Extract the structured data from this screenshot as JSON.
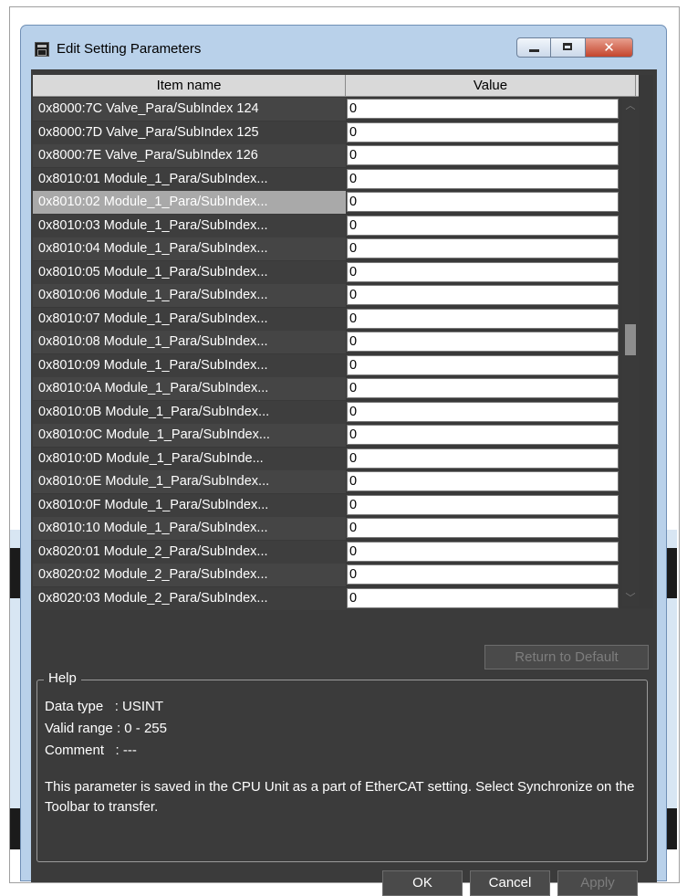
{
  "window": {
    "title": "Edit Setting Parameters",
    "controls": {
      "minimize": "minimize",
      "maximize": "maximize",
      "close": "✕"
    }
  },
  "grid": {
    "headers": {
      "name": "Item name",
      "value": "Value"
    },
    "rows": [
      {
        "name": "0x8000:7C Valve_Para/SubIndex 124",
        "value": "0"
      },
      {
        "name": "0x8000:7D Valve_Para/SubIndex 125",
        "value": "0"
      },
      {
        "name": "0x8000:7E Valve_Para/SubIndex 126",
        "value": "0"
      },
      {
        "name": "0x8010:01 Module_1_Para/SubIndex...",
        "value": "0"
      },
      {
        "name": "0x8010:02 Module_1_Para/SubIndex...",
        "value": "0",
        "selected": true
      },
      {
        "name": "0x8010:03 Module_1_Para/SubIndex...",
        "value": "0"
      },
      {
        "name": "0x8010:04 Module_1_Para/SubIndex...",
        "value": "0"
      },
      {
        "name": "0x8010:05 Module_1_Para/SubIndex...",
        "value": "0"
      },
      {
        "name": "0x8010:06 Module_1_Para/SubIndex...",
        "value": "0"
      },
      {
        "name": "0x8010:07 Module_1_Para/SubIndex...",
        "value": "0"
      },
      {
        "name": "0x8010:08 Module_1_Para/SubIndex...",
        "value": "0"
      },
      {
        "name": "0x8010:09 Module_1_Para/SubIndex...",
        "value": "0"
      },
      {
        "name": "0x8010:0A Module_1_Para/SubIndex...",
        "value": "0"
      },
      {
        "name": "0x8010:0B Module_1_Para/SubIndex...",
        "value": "0"
      },
      {
        "name": "0x8010:0C Module_1_Para/SubIndex...",
        "value": "0"
      },
      {
        "name": "0x8010:0D Module_1_Para/SubInde...",
        "value": "0"
      },
      {
        "name": "0x8010:0E Module_1_Para/SubIndex...",
        "value": "0"
      },
      {
        "name": "0x8010:0F Module_1_Para/SubIndex...",
        "value": "0"
      },
      {
        "name": "0x8010:10 Module_1_Para/SubIndex...",
        "value": "0"
      },
      {
        "name": "0x8020:01 Module_2_Para/SubIndex...",
        "value": "0"
      },
      {
        "name": "0x8020:02 Module_2_Para/SubIndex...",
        "value": "0"
      },
      {
        "name": "0x8020:03 Module_2_Para/SubIndex...",
        "value": "0"
      }
    ]
  },
  "buttons": {
    "return_to_default": "Return to Default",
    "ok": "OK",
    "cancel": "Cancel",
    "apply": "Apply"
  },
  "help": {
    "legend": "Help",
    "data_type": "Data type   : USINT",
    "valid_range": "Valid range : 0 - 255",
    "comment": "Comment   : ---",
    "description": "This parameter is saved in the CPU Unit as a part of EtherCAT setting. Select Synchronize on the Toolbar to transfer."
  }
}
